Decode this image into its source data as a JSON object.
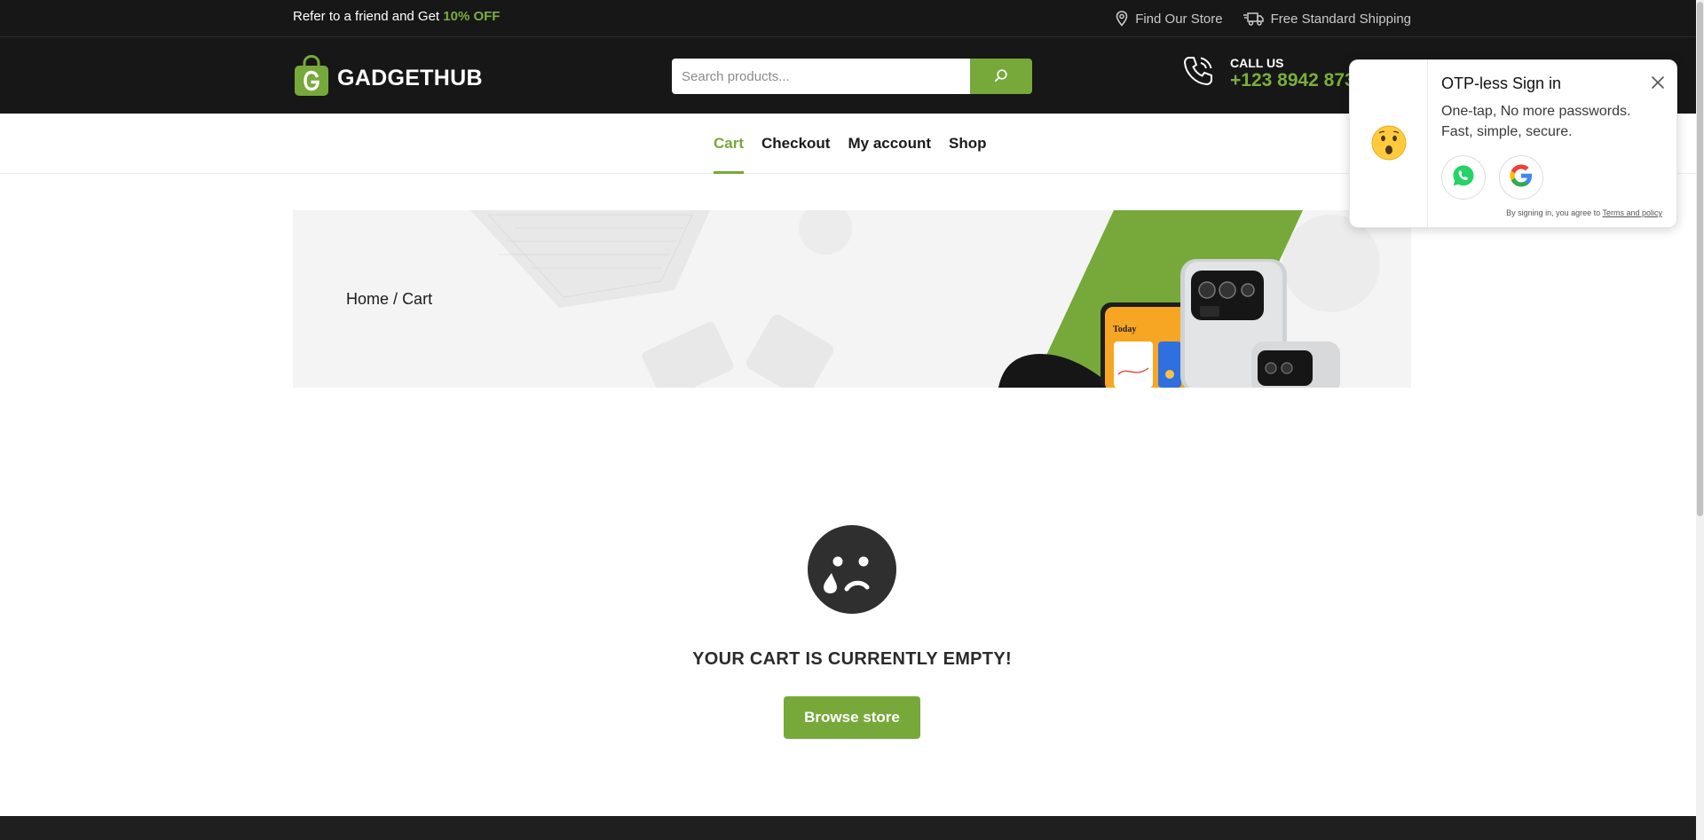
{
  "topbar": {
    "promo_text": "Refer to a friend and Get ",
    "promo_highlight": "10% OFF",
    "store_link": "Find Our Store",
    "shipping_text": "Free Standard Shipping"
  },
  "header": {
    "logo_text": "GADGETHUB",
    "search_placeholder": "Search products...",
    "call_label": "CALL US",
    "call_number": "+123 8942 873"
  },
  "nav": {
    "items": [
      {
        "label": "Cart",
        "active": true
      },
      {
        "label": "Checkout",
        "active": false
      },
      {
        "label": "My account",
        "active": false
      },
      {
        "label": "Shop",
        "active": false
      }
    ]
  },
  "banner": {
    "breadcrumb_home": "Home",
    "breadcrumb_sep": "/",
    "breadcrumb_current": "Cart"
  },
  "cart": {
    "empty_message": "YOUR CART IS CURRENTLY EMPTY!",
    "browse_button": "Browse store"
  },
  "otp_popup": {
    "title": "OTP-less Sign in",
    "description_line1": "One-tap, No more passwords.",
    "description_line2": "Fast, simple, secure.",
    "terms_prefix": "By signing in, you agree to ",
    "terms_link": "Terms and policy"
  },
  "colors": {
    "accent": "#76a93a",
    "dark": "#171717"
  },
  "icons": [
    "location-pin-icon",
    "delivery-truck-icon",
    "search-icon",
    "phone-icon",
    "sad-face-icon",
    "surprised-emoji-icon",
    "whatsapp-icon",
    "google-icon",
    "close-icon"
  ]
}
